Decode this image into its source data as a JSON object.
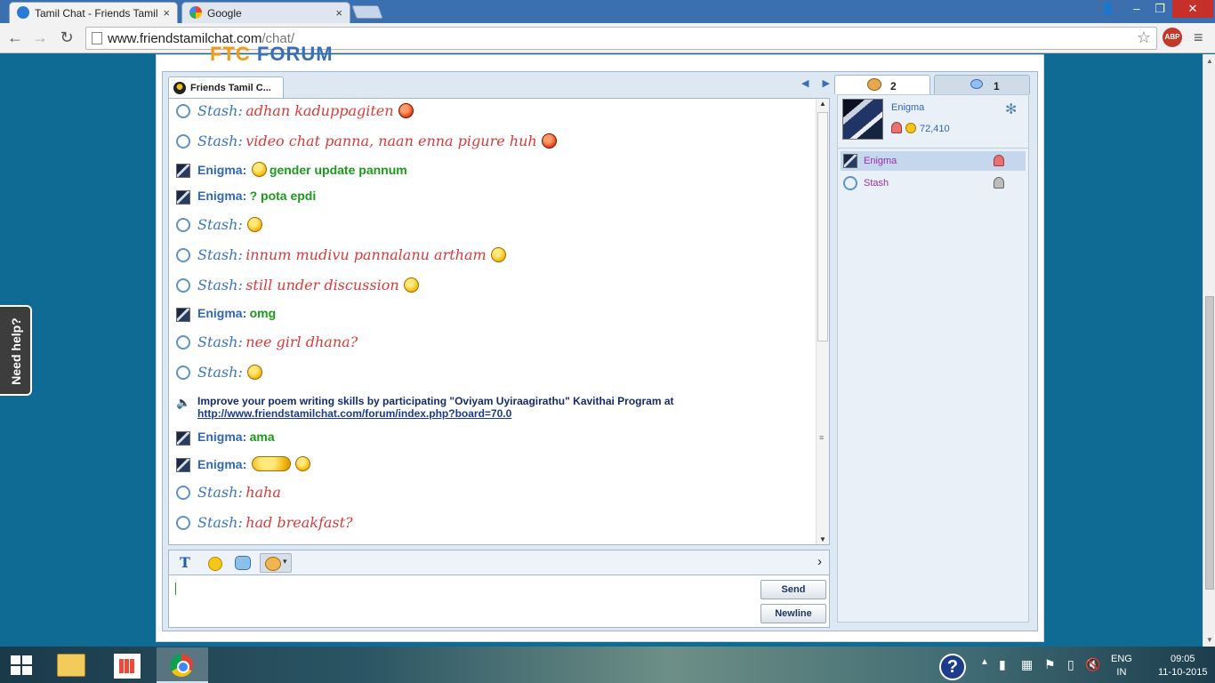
{
  "browser": {
    "tabs": [
      {
        "title": "Tamil Chat - Friends Tamil",
        "close": "×",
        "favicon_color": "#2a7bd5"
      },
      {
        "title": "Google",
        "close": "×",
        "favicon_color": "#4285f4"
      }
    ],
    "url_host": "www.friendstamilchat.com",
    "url_path": "/chat/",
    "abp_label": "ABP",
    "window_controls": {
      "minimize": "–",
      "maximize": "❐",
      "close": "✕"
    }
  },
  "site": {
    "logo_left": "FTC",
    "logo_right": "FORUM"
  },
  "chat": {
    "room_tab_label": "Friends Tamil C...",
    "tab_nav_arrows": "◀ ▶",
    "messages": [
      {
        "user": "Stash",
        "style": "stash",
        "name": "Stash:",
        "text": "adhan kaduppagiten",
        "emoticons": [
          "angry"
        ]
      },
      {
        "user": "Stash",
        "style": "stash",
        "name": "Stash:",
        "text": "video chat panna, naan enna pigure huh",
        "emoticons": [
          "angry"
        ]
      },
      {
        "user": "Enigma",
        "style": "enigma",
        "name": "Enigma:",
        "text": "gender update pannum",
        "emoticons_before": [
          "smile"
        ]
      },
      {
        "user": "Enigma",
        "style": "enigma",
        "name": "Enigma:",
        "text": "? pota epdi",
        "emoticons": []
      },
      {
        "user": "Stash",
        "style": "stash",
        "name": "Stash:",
        "text": "",
        "emoticons": [
          "smile"
        ]
      },
      {
        "user": "Stash",
        "style": "stash",
        "name": "Stash:",
        "text": "innum mudivu pannalanu artham",
        "emoticons": [
          "smile"
        ]
      },
      {
        "user": "Stash",
        "style": "stash",
        "name": "Stash:",
        "text": "still under discussion",
        "emoticons": [
          "smile"
        ]
      },
      {
        "user": "Enigma",
        "style": "enigma",
        "name": "Enigma:",
        "text": "omg",
        "emoticons": []
      },
      {
        "user": "Stash",
        "style": "stash",
        "name": "Stash:",
        "text": "nee girl dhana?",
        "emoticons": []
      },
      {
        "user": "Stash",
        "style": "stash",
        "name": "Stash:",
        "text": "",
        "emoticons": [
          "smile"
        ]
      },
      {
        "user": "Enigma",
        "style": "enigma",
        "name": "Enigma:",
        "text": "ama",
        "emoticons": []
      },
      {
        "user": "Enigma",
        "style": "enigma",
        "name": "Enigma:",
        "text": "",
        "emoticons": [
          "wide",
          "smile"
        ]
      },
      {
        "user": "Stash",
        "style": "stash",
        "name": "Stash:",
        "text": "haha",
        "emoticons": []
      },
      {
        "user": "Stash",
        "style": "stash",
        "name": "Stash:",
        "text": "had breakfast?",
        "emoticons": []
      }
    ],
    "announcement": {
      "text": "Improve your poem writing skills by participating \"Oviyam Uyiraagirathu\" Kavithai Program at",
      "link": "http://www.friendstamilchat.com/forum/index.php?board=70.0"
    },
    "input_toolbar": {
      "text_format": "T",
      "expand_arrow": "›"
    },
    "input_value": "",
    "send_label": "Send",
    "newline_label": "Newline"
  },
  "sidebar": {
    "users_tab_count": "2",
    "chats_tab_count": "1",
    "profile": {
      "name": "Enigma",
      "coins": "72,410"
    },
    "users": [
      {
        "name": "Enigma",
        "gender": "female",
        "selected": true
      },
      {
        "name": "Stash",
        "gender": "unknown",
        "selected": false
      }
    ]
  },
  "help_tab": {
    "label": "Need help?"
  },
  "taskbar": {
    "help_icon": "?",
    "lang_top": "ENG",
    "lang_bottom": "IN",
    "time": "09:05",
    "date": "11-10-2015"
  }
}
